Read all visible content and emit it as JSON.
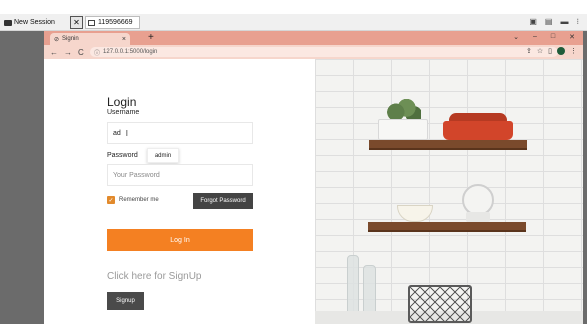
{
  "outer_window": {
    "session_tab": "New Session",
    "close_tab": "✕",
    "remote_id": "119596669",
    "icons": [
      "screen-icon",
      "grid-icon",
      "minus-icon",
      "more-icon"
    ]
  },
  "browser": {
    "tab_title": "Signin",
    "tab_close": "×",
    "new_tab": "+",
    "url": "127.0.0.1:5000/login",
    "nav": {
      "back": "←",
      "forward": "→",
      "reload": "C"
    },
    "window_controls": {
      "collapse": "⌄",
      "minimize": "–",
      "maximize": "□",
      "close": "✕"
    },
    "toolbar_icons": {
      "share": "⇪",
      "star": "☆",
      "sidebar": "▯",
      "menu": "⋮"
    }
  },
  "login": {
    "title": "Login",
    "username_label": "Username",
    "username_value": "ad",
    "password_label": "Password",
    "password_placeholder": "Your Password",
    "autocomplete_suggestion": "admin",
    "remember_label": "Remember me",
    "forgot_button": "Forgot Password",
    "login_button": "Log In",
    "signup_prompt": "Click here for SignUp",
    "signup_button": "Signup"
  },
  "colors": {
    "accent": "#f48022",
    "dark_button": "#444444",
    "tab_strip": "#e8a090",
    "toolbar": "#f6d6cc"
  }
}
